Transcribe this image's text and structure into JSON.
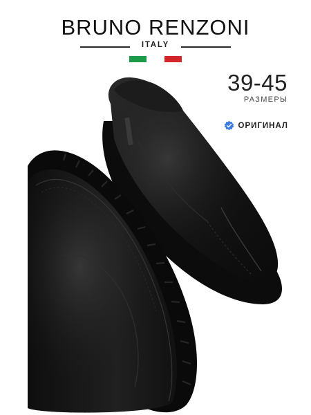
{
  "brand": {
    "name": "BRUNO RENZONI",
    "origin": "ITALY"
  },
  "flag": {
    "green": "#1e9a4b",
    "white": "#ffffff",
    "red": "#d4252b"
  },
  "sizes": {
    "range": "39-45",
    "label": "РАЗМЕРЫ"
  },
  "badge": {
    "text": "ОРИГИНАЛ",
    "icon": "verified-check-icon",
    "color": "#3d7be0"
  },
  "product": {
    "description_icon": "black-leather-slip-on-boots-image"
  }
}
